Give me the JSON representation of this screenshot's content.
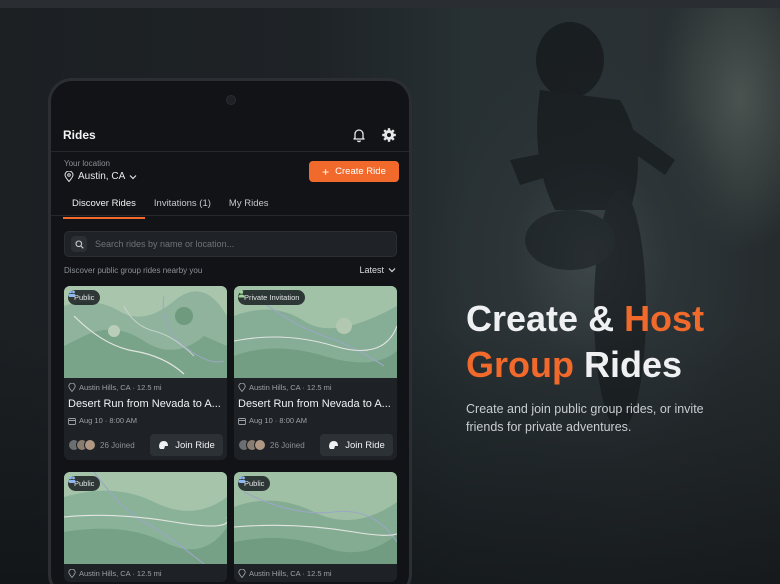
{
  "colors": {
    "accent": "#f26a2b",
    "background": "#1a1d20",
    "phone": "#111316",
    "card": "#1e2226"
  },
  "app": {
    "title": "Rides",
    "header_icons": [
      "bell-icon",
      "gear-icon"
    ],
    "location_label": "Your location",
    "location_value": "Austin, CA",
    "create_button": "Create Ride",
    "tabs": [
      "Discover Rides",
      "Invitations (1)",
      "My Rides"
    ],
    "active_tab": "Discover Rides",
    "search_placeholder": "Search rides by name or location...",
    "filter_text": "Discover public group rides nearby you",
    "sort_value": "Latest"
  },
  "cards": [
    {
      "badge": "Public",
      "badge_icon": "people-icon",
      "location": "Austin Hills, CA · 12.5 mi",
      "title": "Desert Run from Nevada to A...",
      "date": "Aug 10 · 8:00 AM",
      "joined": "26 Joined",
      "button": "Join Ride"
    },
    {
      "badge": "Private Invitation",
      "badge_icon": "person-lock-icon",
      "location": "Austin Hills, CA · 12.5 mi",
      "title": "Desert Run from Nevada to A...",
      "date": "Aug 10 · 8:00 AM",
      "joined": "26 Joined",
      "button": "Join Ride"
    },
    {
      "badge": "Public",
      "badge_icon": "people-icon",
      "location": "Austin Hills, CA · 12.5 mi"
    },
    {
      "badge": "Public",
      "badge_icon": "people-icon",
      "location": "Austin Hills, CA · 12.5 mi"
    }
  ],
  "hero": {
    "line1_white": "Create & ",
    "line1_accent": "Host",
    "line2_accent": "Group",
    "line2_white": " Rides",
    "subtitle": "Create and join public group rides, or invite friends for private adventures."
  }
}
